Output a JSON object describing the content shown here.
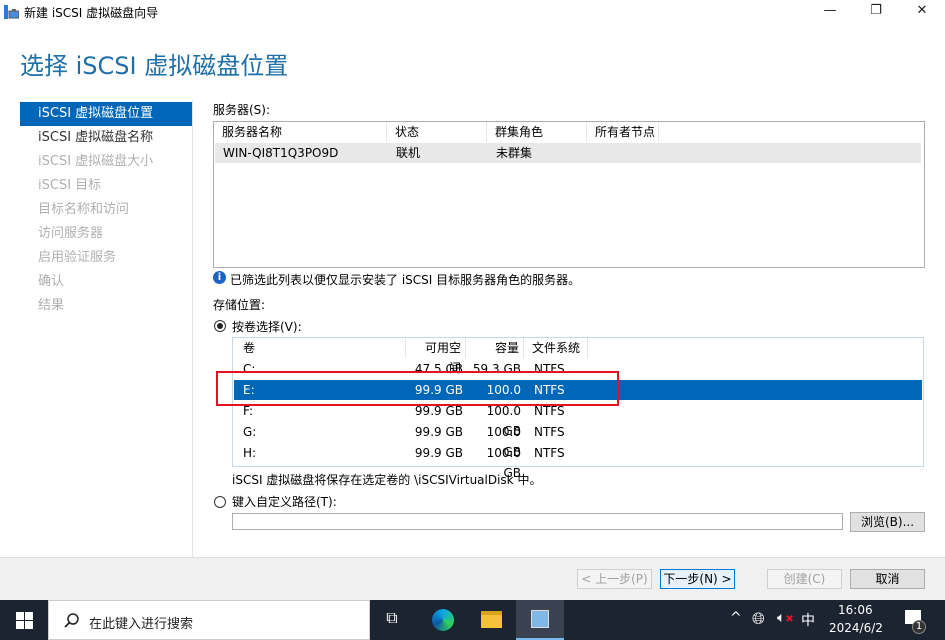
{
  "window": {
    "title": "新建 iSCSI 虚拟磁盘向导",
    "minimize": "—",
    "maximize": "❐",
    "close": "✕"
  },
  "page_title": "选择 iSCSI 虚拟磁盘位置",
  "nav": [
    {
      "label": "iSCSI 虚拟磁盘位置",
      "state": "selected"
    },
    {
      "label": "iSCSI 虚拟磁盘名称",
      "state": "enabled"
    },
    {
      "label": "iSCSI 虚拟磁盘大小",
      "state": "disabled"
    },
    {
      "label": "iSCSI 目标",
      "state": "disabled"
    },
    {
      "label": "目标名称和访问",
      "state": "disabled"
    },
    {
      "label": "访问服务器",
      "state": "disabled"
    },
    {
      "label": "启用验证服务",
      "state": "disabled"
    },
    {
      "label": "确认",
      "state": "disabled"
    },
    {
      "label": "结果",
      "state": "disabled"
    }
  ],
  "servers": {
    "label": "服务器(S):",
    "columns": [
      "服务器名称",
      "状态",
      "群集角色",
      "所有者节点"
    ],
    "rows": [
      [
        "WIN-QI8T1Q3PO9D",
        "联机",
        "未群集",
        ""
      ]
    ]
  },
  "info_text": "已筛选此列表以便仅显示安装了 iSCSI 目标服务器角色的服务器。",
  "storage": {
    "label": "存储位置:",
    "by_volume_label": "按卷选择(V):",
    "columns": [
      "卷",
      "可用空间",
      "容量",
      "文件系统"
    ],
    "rows": [
      [
        "C:",
        "47.5 GB",
        "59.3 GB",
        "NTFS"
      ],
      [
        "E:",
        "99.9 GB",
        "100.0 GB",
        "NTFS"
      ],
      [
        "F:",
        "99.9 GB",
        "100.0 GB",
        "NTFS"
      ],
      [
        "G:",
        "99.9 GB",
        "100.0 GB",
        "NTFS"
      ],
      [
        "H:",
        "99.9 GB",
        "100.0 GB",
        "NTFS"
      ]
    ],
    "selected_row": 1,
    "note": "iSCSI 虚拟磁盘将保存在选定卷的 \\iSCSIVirtualDisk 中。",
    "custom_path_label": "键入自定义路径(T):",
    "custom_path_value": "",
    "browse_label": "浏览(B)..."
  },
  "buttons": {
    "prev": "< 上一步(P)",
    "next": "下一步(N) >",
    "create": "创建(C)",
    "cancel": "取消"
  },
  "taskbar": {
    "search_placeholder": "在此键入进行搜索",
    "time": "16:06",
    "date": "2024/6/2",
    "ime": "中",
    "notifications": "1"
  },
  "colors": {
    "accent": "#0067b8",
    "highlight_box": "#e81123"
  }
}
